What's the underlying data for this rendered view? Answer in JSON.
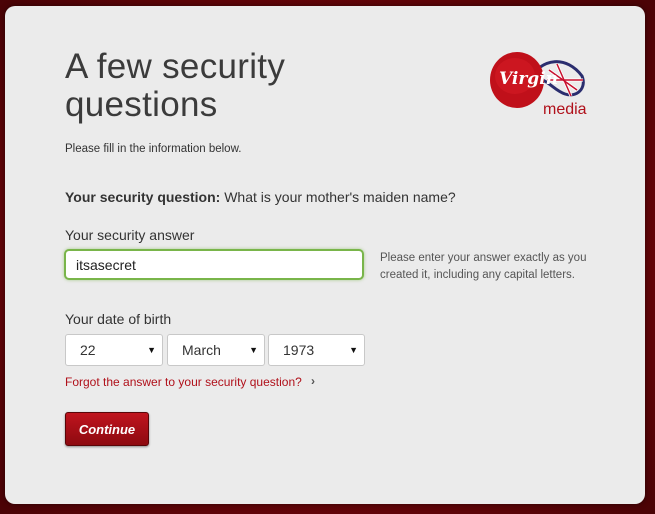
{
  "page": {
    "title": "A few security questions",
    "intro": "Please fill in the information below."
  },
  "brand": {
    "logo_primary": "Virgin",
    "logo_secondary": "media",
    "accent_color": "#b0101a"
  },
  "question": {
    "label": "Your security question:",
    "text": "What is your mother's maiden name?"
  },
  "answer": {
    "label": "Your security answer",
    "value": "itsasecret",
    "hint": "Please enter your answer exactly as you created it, including any capital letters."
  },
  "dob": {
    "label": "Your date of birth",
    "day": "22",
    "month": "March",
    "year": "1973"
  },
  "links": {
    "forgot": "Forgot the answer to your security question?"
  },
  "actions": {
    "continue_label": "Continue"
  },
  "icons": {
    "dropdown": "chevron-down-icon",
    "link_chevron": "chevron-right-icon"
  }
}
